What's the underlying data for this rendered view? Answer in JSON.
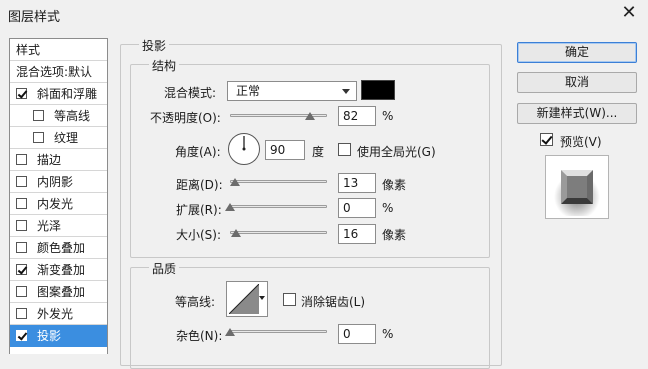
{
  "window": {
    "title": "图层样式",
    "close_glyph": "✕"
  },
  "style_list": {
    "header": "样式",
    "items": [
      {
        "label": "混合选项:默认",
        "checkbox": false,
        "checked": false,
        "indent": false,
        "selected": false
      },
      {
        "label": "斜面和浮雕",
        "checkbox": true,
        "checked": true,
        "indent": false,
        "selected": false
      },
      {
        "label": "等高线",
        "checkbox": true,
        "checked": false,
        "indent": true,
        "selected": false
      },
      {
        "label": "纹理",
        "checkbox": true,
        "checked": false,
        "indent": true,
        "selected": false
      },
      {
        "label": "描边",
        "checkbox": true,
        "checked": false,
        "indent": false,
        "selected": false
      },
      {
        "label": "内阴影",
        "checkbox": true,
        "checked": false,
        "indent": false,
        "selected": false
      },
      {
        "label": "内发光",
        "checkbox": true,
        "checked": false,
        "indent": false,
        "selected": false
      },
      {
        "label": "光泽",
        "checkbox": true,
        "checked": false,
        "indent": false,
        "selected": false
      },
      {
        "label": "颜色叠加",
        "checkbox": true,
        "checked": false,
        "indent": false,
        "selected": false
      },
      {
        "label": "渐变叠加",
        "checkbox": true,
        "checked": true,
        "indent": false,
        "selected": false
      },
      {
        "label": "图案叠加",
        "checkbox": true,
        "checked": false,
        "indent": false,
        "selected": false
      },
      {
        "label": "外发光",
        "checkbox": true,
        "checked": false,
        "indent": false,
        "selected": false
      },
      {
        "label": "投影",
        "checkbox": true,
        "checked": true,
        "indent": false,
        "selected": true
      }
    ]
  },
  "drop_shadow": {
    "section_title": "投影",
    "structure": {
      "title": "结构",
      "blend_mode_label": "混合模式:",
      "blend_mode_value": "正常",
      "shadow_color": "#000000",
      "opacity_label": "不透明度(O):",
      "opacity_value": "82",
      "opacity_unit": "%",
      "opacity_fraction": 0.82,
      "angle_label": "角度(A):",
      "angle_value": "90",
      "angle_unit": "度",
      "global_light_label": "使用全局光(G)",
      "global_light_checked": false,
      "distance_label": "距离(D):",
      "distance_value": "13",
      "distance_unit": "像素",
      "distance_fraction": 0.05,
      "spread_label": "扩展(R):",
      "spread_value": "0",
      "spread_unit": "%",
      "spread_fraction": 0.0,
      "size_label": "大小(S):",
      "size_value": "16",
      "size_unit": "像素",
      "size_fraction": 0.06
    },
    "quality": {
      "title": "品质",
      "contour_label": "等高线:",
      "anti_alias_label": "消除锯齿(L)",
      "anti_alias_checked": false,
      "noise_label": "杂色(N):",
      "noise_value": "0",
      "noise_unit": "%",
      "noise_fraction": 0.0
    }
  },
  "buttons": {
    "ok": "确定",
    "cancel": "取消",
    "new_style": "新建样式(W)...",
    "preview_label": "预览(V)",
    "preview_checked": true
  },
  "colors": {
    "selection": "#3b8ee0",
    "default_button_border": "#3b7fd6"
  },
  "icons": {
    "close": "close-icon",
    "angle_dial": "angle-dial-icon",
    "contour": "contour-curve-icon",
    "dropdown": "chevron-down-icon"
  }
}
